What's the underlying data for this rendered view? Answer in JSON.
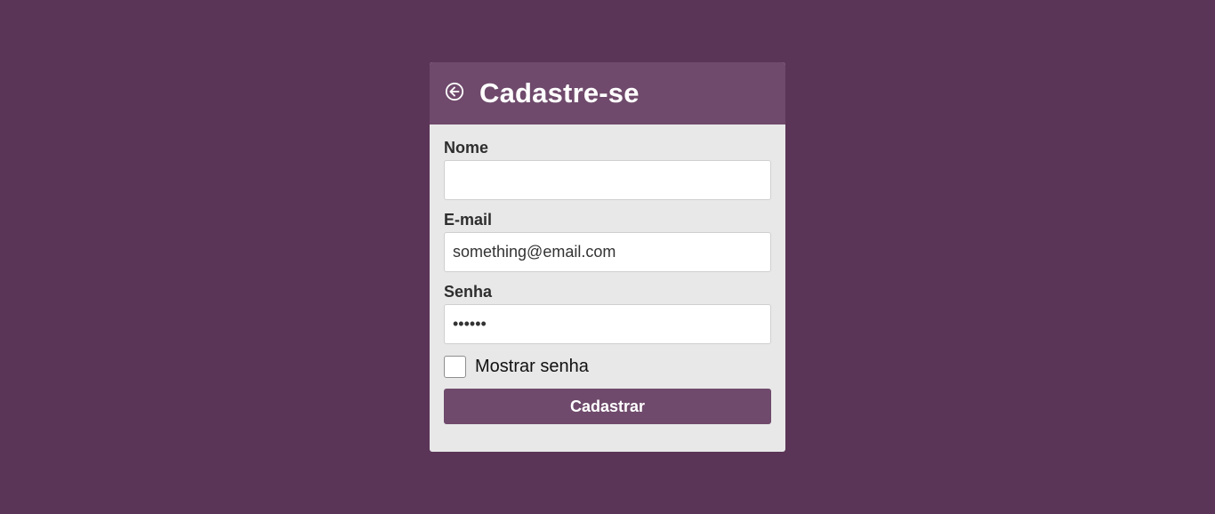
{
  "header": {
    "title": "Cadastre-se",
    "back_icon": "arrow-left-circle-icon"
  },
  "form": {
    "name": {
      "label": "Nome",
      "value": "",
      "placeholder": ""
    },
    "email": {
      "label": "E-mail",
      "value": "something@email.com"
    },
    "password": {
      "label": "Senha",
      "value": "••••••"
    },
    "show_password": {
      "label": "Mostrar senha",
      "checked": false
    },
    "submit_label": "Cadastrar"
  },
  "colors": {
    "page_background": "#5a3557",
    "accent": "#6f4a6c",
    "card_background": "#e8e8e8"
  }
}
